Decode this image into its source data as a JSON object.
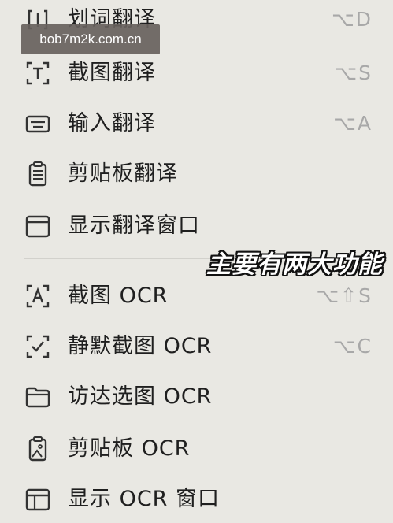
{
  "watermark": "bob7m2k.com.cn",
  "overlay_text": "主要有两大功能",
  "menu": {
    "translation": [
      {
        "label": "划词翻译",
        "shortcut": "⌥D",
        "icon": "bracket-select-icon"
      },
      {
        "label": "截图翻译",
        "shortcut": "⌥S",
        "icon": "screenshot-text-icon"
      },
      {
        "label": "输入翻译",
        "shortcut": "⌥A",
        "icon": "keyboard-icon"
      },
      {
        "label": "剪贴板翻译",
        "shortcut": "",
        "icon": "clipboard-icon"
      },
      {
        "label": "显示翻译窗口",
        "shortcut": "",
        "icon": "window-icon"
      }
    ],
    "ocr": [
      {
        "label": "截图 OCR",
        "shortcut": "⌥⇧S",
        "icon": "screenshot-ocr-icon"
      },
      {
        "label": "静默截图 OCR",
        "shortcut": "⌥C",
        "icon": "silent-screenshot-icon"
      },
      {
        "label": "访达选图 OCR",
        "shortcut": "",
        "icon": "folder-icon"
      },
      {
        "label": "剪贴板 OCR",
        "shortcut": "",
        "icon": "clipboard-image-icon"
      },
      {
        "label": "显示 OCR 窗口",
        "shortcut": "",
        "icon": "ocr-window-icon"
      }
    ]
  }
}
